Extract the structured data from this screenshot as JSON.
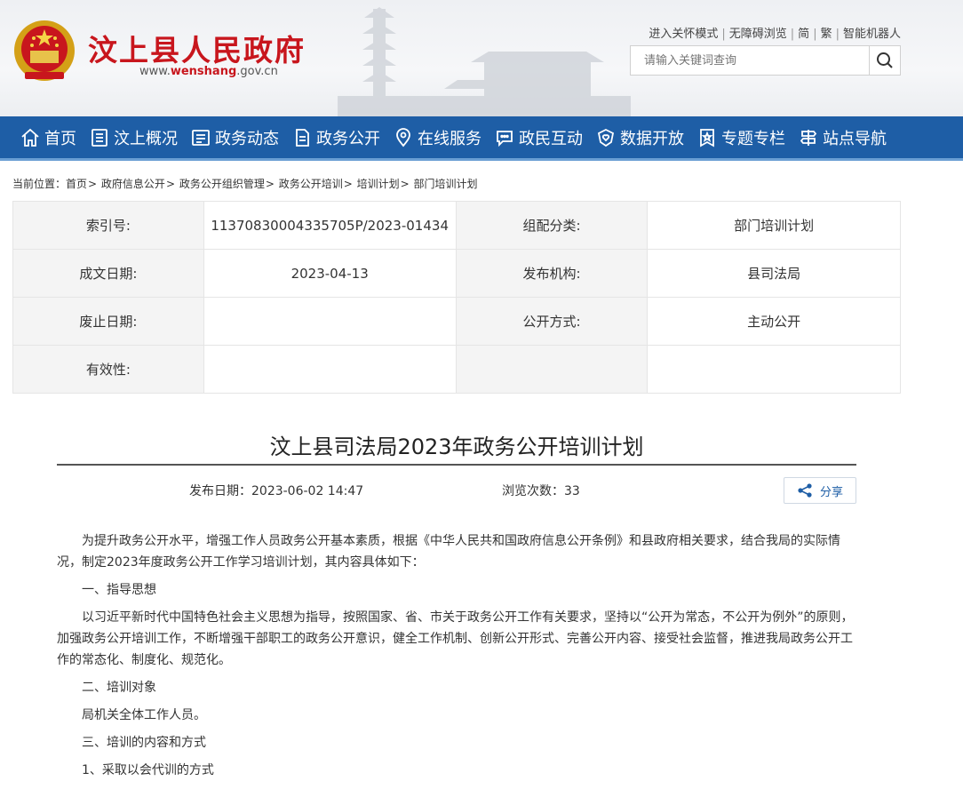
{
  "header": {
    "site_title": "汶上县人民政府",
    "url_prefix": "www.",
    "url_brand": "wenshang",
    "url_suffix": ".gov.cn",
    "top_links": [
      "进入关怀模式",
      "无障碍浏览",
      "简",
      "繁",
      "智能机器人"
    ],
    "search_placeholder": "请输入关键词查询",
    "emblem_icon": "national-emblem-icon",
    "brand_color": "#c8161d"
  },
  "nav": {
    "color": "#1e5ea6",
    "items": [
      {
        "label": "首页",
        "icon": "home-icon"
      },
      {
        "label": "汶上概况",
        "icon": "book-icon"
      },
      {
        "label": "政务动态",
        "icon": "list-icon"
      },
      {
        "label": "政务公开",
        "icon": "document-icon"
      },
      {
        "label": "在线服务",
        "icon": "location-icon"
      },
      {
        "label": "政民互动",
        "icon": "chat-icon"
      },
      {
        "label": "数据开放",
        "icon": "heart-shield-icon"
      },
      {
        "label": "专题专栏",
        "icon": "star-badge-icon"
      },
      {
        "label": "站点导航",
        "icon": "signpost-icon"
      }
    ]
  },
  "breadcrumb": {
    "prefix": "当前位置：",
    "items": [
      "首页",
      "政府信息公开",
      "政务公开组织管理",
      "政务公开培训",
      "培训计划",
      "部门培训计划"
    ],
    "sep": ">"
  },
  "meta": {
    "rows": [
      {
        "k1": "索引号:",
        "v1": "11370830004335705P/2023-01434",
        "k2": "组配分类:",
        "v2": "部门培训计划"
      },
      {
        "k1": "成文日期:",
        "v1": "2023-04-13",
        "k2": "发布机构:",
        "v2": "县司法局"
      },
      {
        "k1": "废止日期:",
        "v1": "",
        "k2": "公开方式:",
        "v2": "主动公开"
      },
      {
        "k1": "有效性:",
        "v1": "",
        "k2": "",
        "v2": ""
      }
    ]
  },
  "article": {
    "title": "汶上县司法局2023年政务公开培训计划",
    "pub_date": "发布日期：2023-06-02 14:47",
    "views": "浏览次数：33",
    "share_label": "分享",
    "paragraphs": [
      "为提升政务公开水平，增强工作人员政务公开基本素质，根据《中华人民共和国政府信息公开条例》和县政府相关要求，结合我局的实际情况，制定2023年度政务公开工作学习培训计划，其内容具体如下：",
      "一、指导思想",
      "以习近平新时代中国特色社会主义思想为指导，按照国家、省、市关于政务公开工作有关要求，坚持以“公开为常态，不公开为例外”的原则，加强政务公开培训工作，不断增强干部职工的政务公开意识，健全工作机制、创新公开形式、完善公开内容、接受社会监督，推进我局政务公开工作的常态化、制度化、规范化。",
      "二、培训对象",
      "局机关全体工作人员。",
      "三、培训的内容和方式",
      "1、采取以会代训的方式"
    ]
  }
}
